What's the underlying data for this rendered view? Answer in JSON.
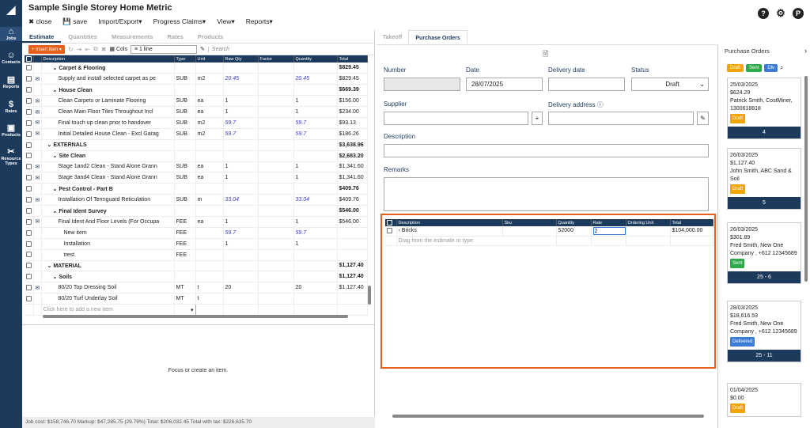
{
  "app": {
    "title": "Sample Single Storey Home Metric",
    "menu": [
      "close",
      "save",
      "Import/Export",
      "Progress Claims",
      "View",
      "Reports"
    ]
  },
  "sidebar": {
    "items": [
      {
        "label": "Jobs",
        "icon": "house-icon"
      },
      {
        "label": "Contacts",
        "icon": "person-icon"
      },
      {
        "label": "Reports",
        "icon": "report-icon"
      },
      {
        "label": "Rates",
        "icon": "rates-icon"
      },
      {
        "label": "Products",
        "icon": "box-icon"
      },
      {
        "label": "Resource Types",
        "icon": "tools-icon"
      }
    ]
  },
  "left": {
    "tabs": [
      "Estimate",
      "Quantities",
      "Measurements",
      "Rates",
      "Products"
    ],
    "toolbar": {
      "insert_label": "Insert item",
      "cols_label": "Cols",
      "lines_value": "1 line",
      "search_placeholder": "Search"
    },
    "columns": [
      "Description",
      "Type",
      "Unit",
      "Raw Qty",
      "Factor",
      "Quantity",
      "Total"
    ],
    "rows": [
      {
        "desc": "Carpet & Flooring",
        "type": "",
        "unit": "",
        "raw": "",
        "factor": "",
        "qty": "",
        "total": "$829.45",
        "indent": 2,
        "group": true,
        "chev": "v"
      },
      {
        "desc": "Supply and install selected carpet as pe",
        "type": "SUB",
        "unit": "m2",
        "raw": "20.45",
        "factor": "",
        "qty": "20.45",
        "total": "$829.45",
        "indent": 3,
        "group": false,
        "mail": true,
        "it": true
      },
      {
        "desc": "House Clean",
        "type": "",
        "unit": "",
        "raw": "",
        "factor": "",
        "qty": "",
        "total": "$669.39",
        "indent": 2,
        "group": true,
        "chev": "v"
      },
      {
        "desc": "Clean Carpets or Laminate Flooring",
        "type": "SUB",
        "unit": "ea",
        "raw": "1",
        "factor": "",
        "qty": "1",
        "total": "$156.00",
        "indent": 3,
        "group": false,
        "mail": true
      },
      {
        "desc": "Clean Main Floor Tiles Throughout Incl",
        "type": "SUB",
        "unit": "ea",
        "raw": "1",
        "factor": "",
        "qty": "1",
        "total": "$234.00",
        "indent": 3,
        "group": false,
        "mail": true
      },
      {
        "desc": "Final touch up clean prior to handover",
        "type": "SUB",
        "unit": "m2",
        "raw": "59.7",
        "factor": "",
        "qty": "59.7",
        "total": "$93.13",
        "indent": 3,
        "group": false,
        "mail": true,
        "it": true
      },
      {
        "desc": "Initial Detailed House Clean - Excl Garag",
        "type": "SUB",
        "unit": "m2",
        "raw": "59.7",
        "factor": "",
        "qty": "59.7",
        "total": "$186.26",
        "indent": 3,
        "group": false,
        "mail": true,
        "it": true
      },
      {
        "desc": "EXTERNALS",
        "type": "",
        "unit": "",
        "raw": "",
        "factor": "",
        "qty": "",
        "total": "$3,638.96",
        "indent": 1,
        "group": true,
        "chev": "v"
      },
      {
        "desc": "Site Clean",
        "type": "",
        "unit": "",
        "raw": "",
        "factor": "",
        "qty": "",
        "total": "$2,683.20",
        "indent": 2,
        "group": true,
        "chev": "v"
      },
      {
        "desc": "Stage 1and2 Clean - Stand Alone Grann",
        "type": "SUB",
        "unit": "ea",
        "raw": "1",
        "factor": "",
        "qty": "1",
        "total": "$1,341.60",
        "indent": 3,
        "group": false,
        "mail": true
      },
      {
        "desc": "Stage 3and4 Clean - Stand Alone Grann",
        "type": "SUB",
        "unit": "ea",
        "raw": "1",
        "factor": "",
        "qty": "1",
        "total": "$1,341.60",
        "indent": 3,
        "group": false,
        "mail": true
      },
      {
        "desc": "Pest Control - Part B",
        "type": "",
        "unit": "",
        "raw": "",
        "factor": "",
        "qty": "",
        "total": "$409.76",
        "indent": 2,
        "group": true,
        "chev": "v"
      },
      {
        "desc": "Installation Of Termguard Reticulation",
        "type": "SUB",
        "unit": "m",
        "raw": "33.04",
        "factor": "",
        "qty": "33.04",
        "total": "$409.76",
        "indent": 3,
        "group": false,
        "mail": true,
        "it": true
      },
      {
        "desc": "Final Ident Survey",
        "type": "",
        "unit": "",
        "raw": "",
        "factor": "",
        "qty": "",
        "total": "$546.00",
        "indent": 2,
        "group": true,
        "chev": "v"
      },
      {
        "desc": "Final Ident And Floor Levels (For Occupa",
        "type": "FEE",
        "unit": "ea",
        "raw": "1",
        "factor": "",
        "qty": "1",
        "total": "$546.00",
        "indent": 3,
        "group": false,
        "mail": true
      },
      {
        "desc": "New item",
        "type": "FEE",
        "unit": "",
        "raw": "59.7",
        "factor": "",
        "qty": "59.7",
        "total": "",
        "indent": 4,
        "group": false,
        "it": true
      },
      {
        "desc": "Installation",
        "type": "FEE",
        "unit": "",
        "raw": "1",
        "factor": "",
        "qty": "1",
        "total": "",
        "indent": 4,
        "group": false
      },
      {
        "desc": "trest",
        "type": "FEE",
        "unit": "",
        "raw": "",
        "factor": "",
        "qty": "",
        "total": "",
        "indent": 4,
        "group": false
      },
      {
        "desc": "MATERIAL",
        "type": "",
        "unit": "",
        "raw": "",
        "factor": "",
        "qty": "",
        "total": "$1,127.40",
        "indent": 1,
        "group": true,
        "chev": "v"
      },
      {
        "desc": "Soils",
        "type": "",
        "unit": "",
        "raw": "",
        "factor": "",
        "qty": "",
        "total": "$1,127.40",
        "indent": 2,
        "group": true,
        "chev": "v"
      },
      {
        "desc": "80/20 Top Dressing Soil",
        "type": "MT",
        "unit": "t",
        "raw": "20",
        "factor": "",
        "qty": "20",
        "total": "$1,127.40",
        "indent": 3,
        "group": false,
        "mail": true
      },
      {
        "desc": "80/20 Turf Underlay Soil",
        "type": "MT",
        "unit": "t",
        "raw": "",
        "factor": "",
        "qty": "",
        "total": "",
        "indent": 3,
        "group": false
      }
    ],
    "add_row_placeholder": "Click here to add a new item",
    "focus_text": "Focus or create an item.",
    "footer": "Job cost: $158,746.70 Markup: $47,285.75 (29.79%) Total: $206,032.45 Total with tax: $226,635.70"
  },
  "mid": {
    "tabs": [
      "Takeoff",
      "Purchase Orders"
    ],
    "labels": {
      "number": "Number",
      "date": "Date",
      "delivery_date": "Delivery date",
      "status": "Status",
      "supplier": "Supplier",
      "delivery_address": "Delivery address ⓘ",
      "description": "Description",
      "remarks": "Remarks"
    },
    "values": {
      "date": "28/07/2025",
      "status": "Draft"
    },
    "po_columns": [
      "Description",
      "Sku",
      "Quantity",
      "Rate",
      "Ordering Unit",
      "Total"
    ],
    "po_rows": [
      {
        "desc": "Bricks",
        "sku": "",
        "qty": "52000",
        "rate": "2",
        "unit": "",
        "total": "$104,000.00"
      }
    ],
    "po_drag_placeholder": "Drag from the estimate or type"
  },
  "right": {
    "title": "Purchase Orders",
    "chips": [
      {
        "label": "Draft",
        "color": "#f0a500"
      },
      {
        "label": "Sent",
        "color": "#2eaa4a"
      },
      {
        "label": "Dlv",
        "color": "#3a7bd5"
      }
    ],
    "cards": [
      {
        "date": "25/03/2025",
        "amount": "$624.29",
        "lines": [
          "Patrick Smith, CostMiner, 1300618818"
        ],
        "status": "Draft",
        "status_color": "#f0a500",
        "foot": "4"
      },
      {
        "date": "26/03/2025",
        "amount": "$1,127.40",
        "lines": [
          "John Smith, ABC Sand & Soil"
        ],
        "status": "Draft",
        "status_color": "#f0a500",
        "foot": "5"
      },
      {
        "date": "26/03/2025",
        "amount": "$301.89",
        "lines": [
          "Fred Smith, New One Company , +612 12345689"
        ],
        "status": "Sent",
        "status_color": "#2eaa4a",
        "foot": "25 - 6"
      },
      {
        "date": "28/03/2025",
        "amount": "$18,616.53",
        "lines": [
          "Fred Smith, New One Company , +612 12345689"
        ],
        "status": "Delivered",
        "status_color": "#3a7bd5",
        "foot": "25 - 11"
      },
      {
        "date": "01/04/2025",
        "amount": "$0.00",
        "lines": [],
        "status": "Draft",
        "status_color": "#f0a500",
        "foot": ""
      }
    ]
  }
}
